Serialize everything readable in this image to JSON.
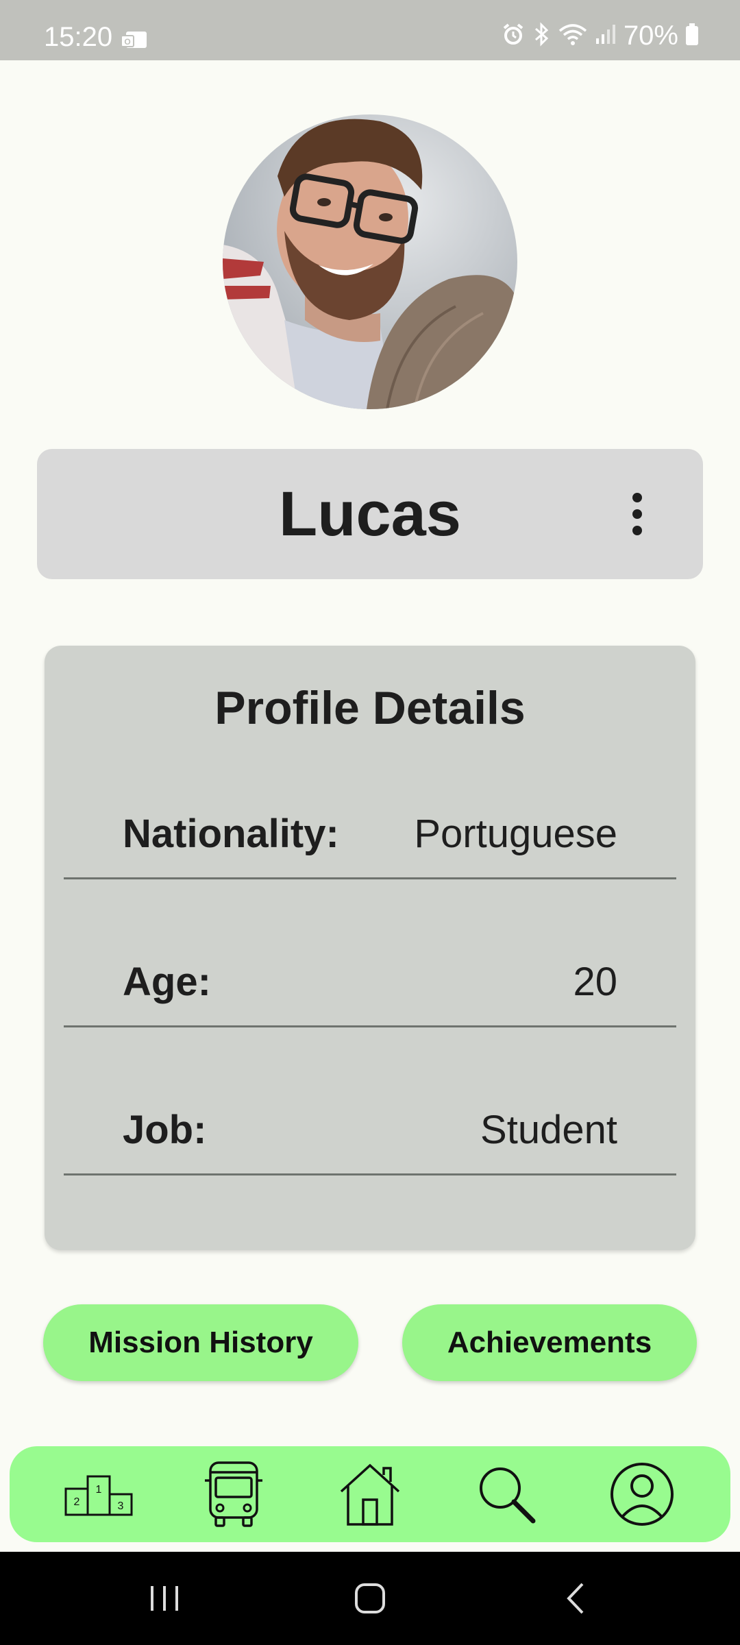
{
  "status_bar": {
    "time": "15:20",
    "battery_percent": "70%",
    "icons": [
      "mail-icon",
      "alarm-icon",
      "bluetooth-icon",
      "wifi-icon",
      "signal-icon",
      "battery-icon"
    ]
  },
  "profile": {
    "name": "Lucas",
    "avatar": "profile-photo"
  },
  "details": {
    "title": "Profile Details",
    "rows": [
      {
        "label": "Nationality:",
        "value": "Portuguese"
      },
      {
        "label": "Age:",
        "value": "20"
      },
      {
        "label": "Job:",
        "value": "Student"
      }
    ]
  },
  "actions": {
    "mission_history_label": "Mission History",
    "achievements_label": "Achievements"
  },
  "bottom_nav": {
    "items": [
      "leaderboard-icon",
      "bus-icon",
      "home-icon",
      "search-icon",
      "profile-icon"
    ]
  },
  "colors": {
    "accent": "#98f58a",
    "card": "#cfd2cd",
    "name_bar": "#d9d9d9",
    "background": "#fafbf5",
    "status_bar": "#c0c1bc"
  }
}
